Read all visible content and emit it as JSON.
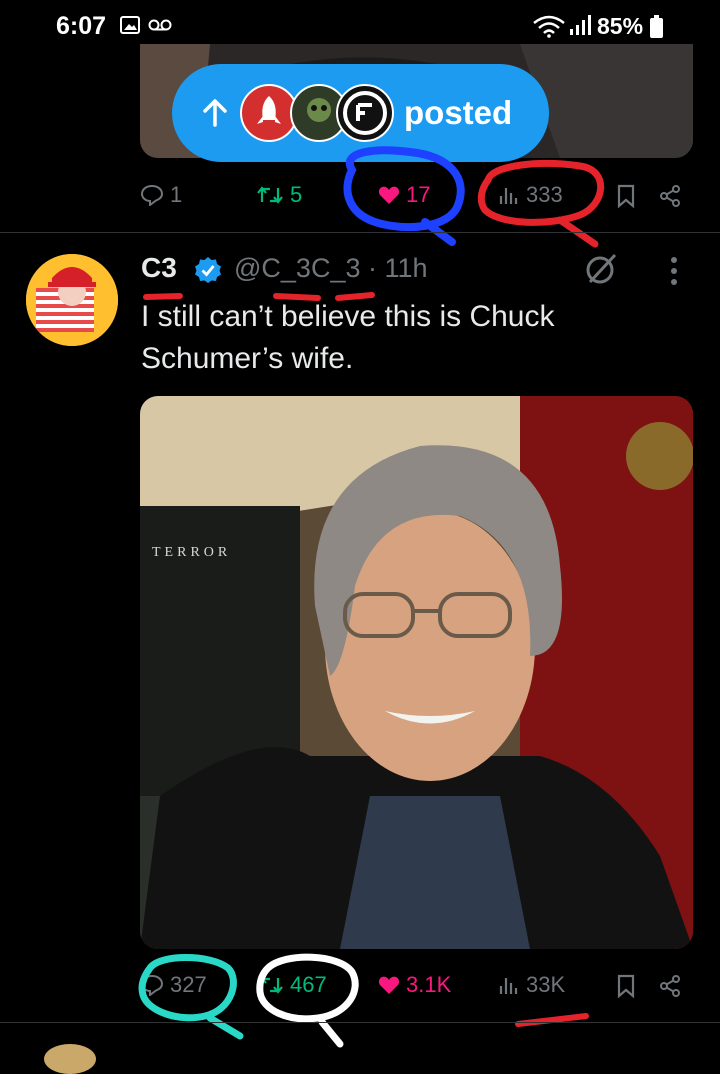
{
  "status_bar": {
    "time": "6:07",
    "battery": "85%",
    "icons": [
      "gallery-icon",
      "voicemail-icon",
      "wifi-icon",
      "signal-icon",
      "battery-icon"
    ]
  },
  "previous_post": {
    "posted_pill": {
      "label": "posted",
      "icons": [
        "arrow-up-icon"
      ]
    },
    "actions": {
      "replies": "1",
      "reposts": "5",
      "likes": "17",
      "views": "333"
    }
  },
  "post": {
    "display_name": "C3",
    "handle": "@C_3C_3",
    "time": "· 11h",
    "text": "I still can’t believe this is Chuck Schumer’s wife.",
    "image_sign_text": "TERROR",
    "actions": {
      "replies": "327",
      "reposts": "467",
      "likes": "3.1K",
      "views": "33K"
    }
  },
  "colors": {
    "background": "#000000",
    "accent": "#1d9bf0",
    "repost_green": "#00ba7c",
    "like_pink": "#f91880",
    "muted": "#71767b",
    "annotation_blue": "#1e40ff",
    "annotation_red": "#e5232a",
    "annotation_teal": "#2ad8c8"
  }
}
